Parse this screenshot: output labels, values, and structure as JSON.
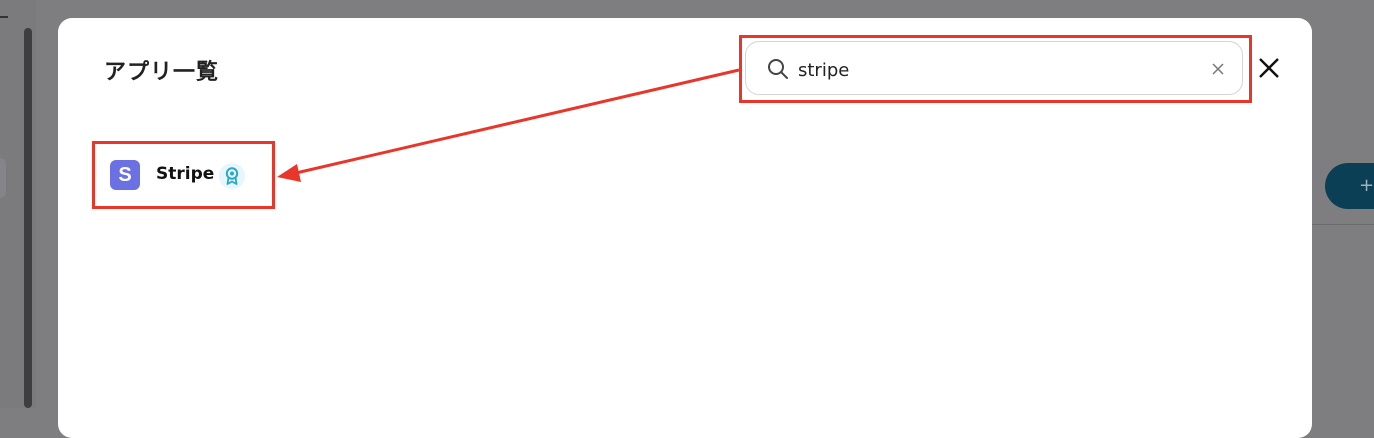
{
  "modal": {
    "title": "アプリ一覧",
    "search": {
      "value": "stripe",
      "placeholder": ""
    }
  },
  "results": [
    {
      "name": "Stripe",
      "logo_letter": "S",
      "logo_color": "#6b71e2",
      "badge_icon": "award-ribbon-icon"
    }
  ],
  "background": {
    "fab_label": "+"
  },
  "colors": {
    "annotation": "#e8372a",
    "badge": "#2aa8c9"
  }
}
